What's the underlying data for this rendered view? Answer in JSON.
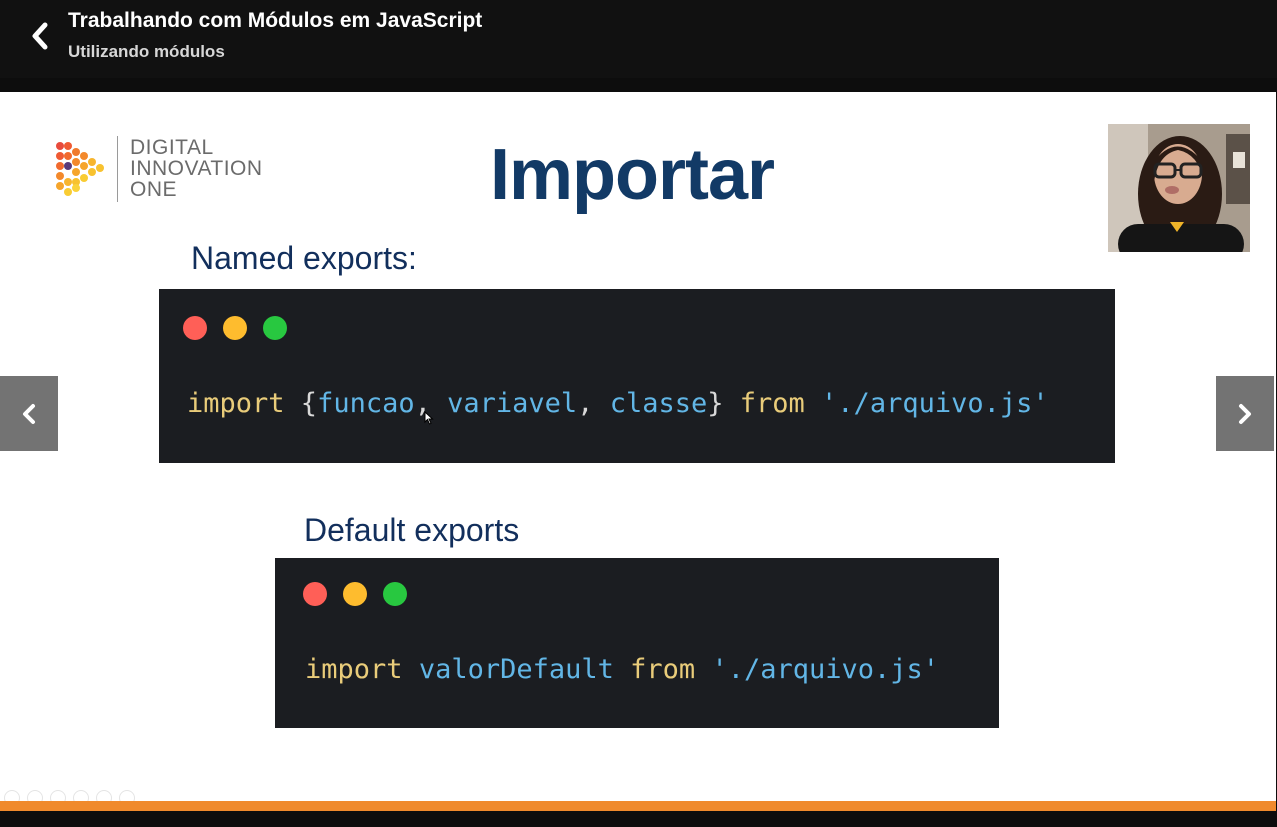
{
  "header": {
    "back_icon": "chevron-left-icon",
    "course_title": "Trabalhando com Módulos em JavaScript",
    "lesson_title": "Utilizando módulos"
  },
  "slide": {
    "logo": {
      "line1": "DIGITAL",
      "line2": "INNOVATION",
      "line3": "ONE"
    },
    "title": "Importar",
    "named": {
      "label": "Named exports:",
      "code": {
        "kw_import": "import",
        "brace_open": " {",
        "id1": "funcao",
        "comma1": ", ",
        "id2": "variavel",
        "comma2": ", ",
        "id3": "classe",
        "brace_close": "} ",
        "kw_from": "from",
        "space": " ",
        "path": "'./arquivo.js'"
      }
    },
    "default": {
      "label": "Default exports",
      "code": {
        "kw_import": "import",
        "space1": " ",
        "id1": "valorDefault",
        "space2": " ",
        "kw_from": "from",
        "space3": " ",
        "path": "'./arquivo.js'"
      }
    }
  },
  "player": {
    "prev_icon": "chevron-left-icon",
    "next_icon": "chevron-right-icon",
    "progress": 1.0
  },
  "colors": {
    "accent_orange": "#f08a2c",
    "title_blue": "#123a66",
    "code_bg": "#1b1d21",
    "keyword": "#e9cc7a",
    "identifier": "#62b6e6",
    "dot_red": "#ff5f57",
    "dot_yellow": "#febc2e",
    "dot_green": "#28c840"
  }
}
